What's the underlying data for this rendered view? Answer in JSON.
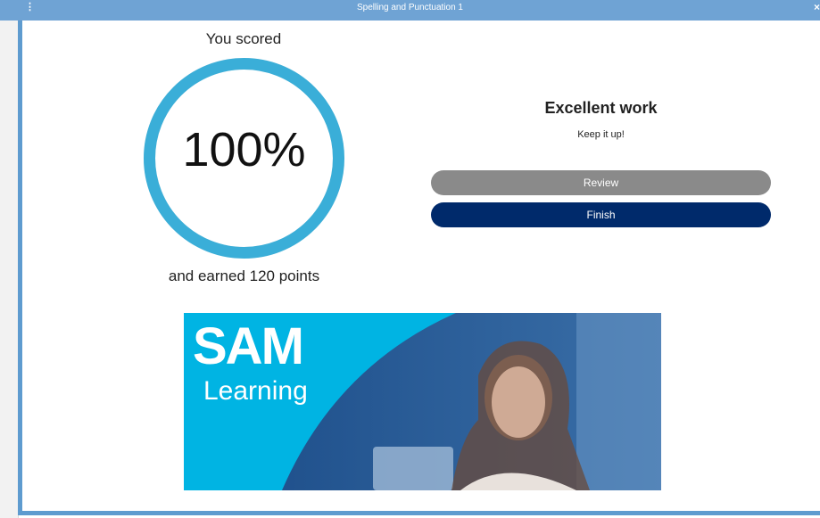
{
  "window": {
    "title": "Spelling and Punctuation 1",
    "menu_icon": "vertical-dots-icon",
    "close_icon": "close-icon",
    "close_glyph": "×"
  },
  "result": {
    "score_label": "You scored",
    "percent_text": "100%",
    "percent_value": 100,
    "points_label": "and earned 120 points"
  },
  "feedback": {
    "title": "Excellent work",
    "subtitle": "Keep it up!"
  },
  "buttons": {
    "review_label": "Review",
    "finish_label": "Finish"
  },
  "banner": {
    "logo_top": "SAM",
    "logo_bottom": "Learning"
  },
  "colors": {
    "titlebar": "#6fa3d4",
    "ring": "#3aaed8",
    "review_button": "#8a8a8a",
    "finish_button": "#002a6b",
    "banner_cyan": "#00b4e3",
    "banner_navy": "#1d4f8c"
  }
}
